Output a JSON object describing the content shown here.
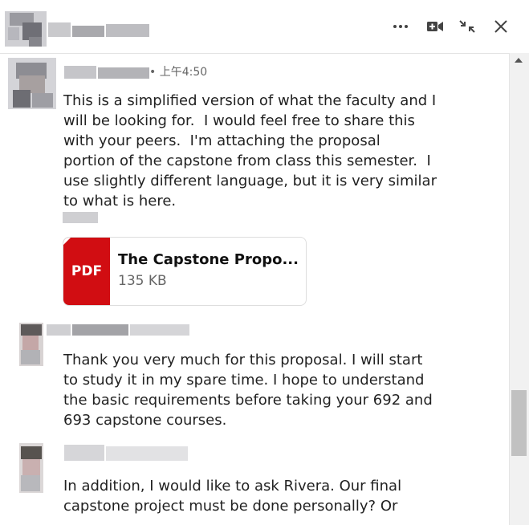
{
  "header": {
    "more_icon": "more-dots-icon",
    "video_icon": "video-call-icon",
    "minimize_icon": "minimize-icon",
    "close_icon": "close-icon"
  },
  "messages": [
    {
      "timestamp": "• 上午4:50",
      "lines": [
        "This is a simplified version of what the faculty and I",
        "will be looking for.  I would feel free to share this",
        "with your peers.  I'm attaching the proposal",
        "portion of the capstone from class this semester.  I",
        "use slightly different language, but it is very similar",
        "to what is here."
      ],
      "attachment": {
        "type_label": "PDF",
        "file_name": "The Capstone Propo...",
        "file_size": "135 KB"
      }
    },
    {
      "lines": [
        "Thank you very much for this proposal. I will start",
        "to study it in my spare time. I hope to understand",
        "the basic requirements before taking your 692 and",
        "693 capstone courses."
      ]
    },
    {
      "lines": [
        "In addition, I would like to ask Rivera. Our final",
        "capstone project must be done personally? Or"
      ]
    }
  ],
  "colors": {
    "pdf_red": "#d10d12",
    "scroll_thumb": "#c1c1c1"
  }
}
